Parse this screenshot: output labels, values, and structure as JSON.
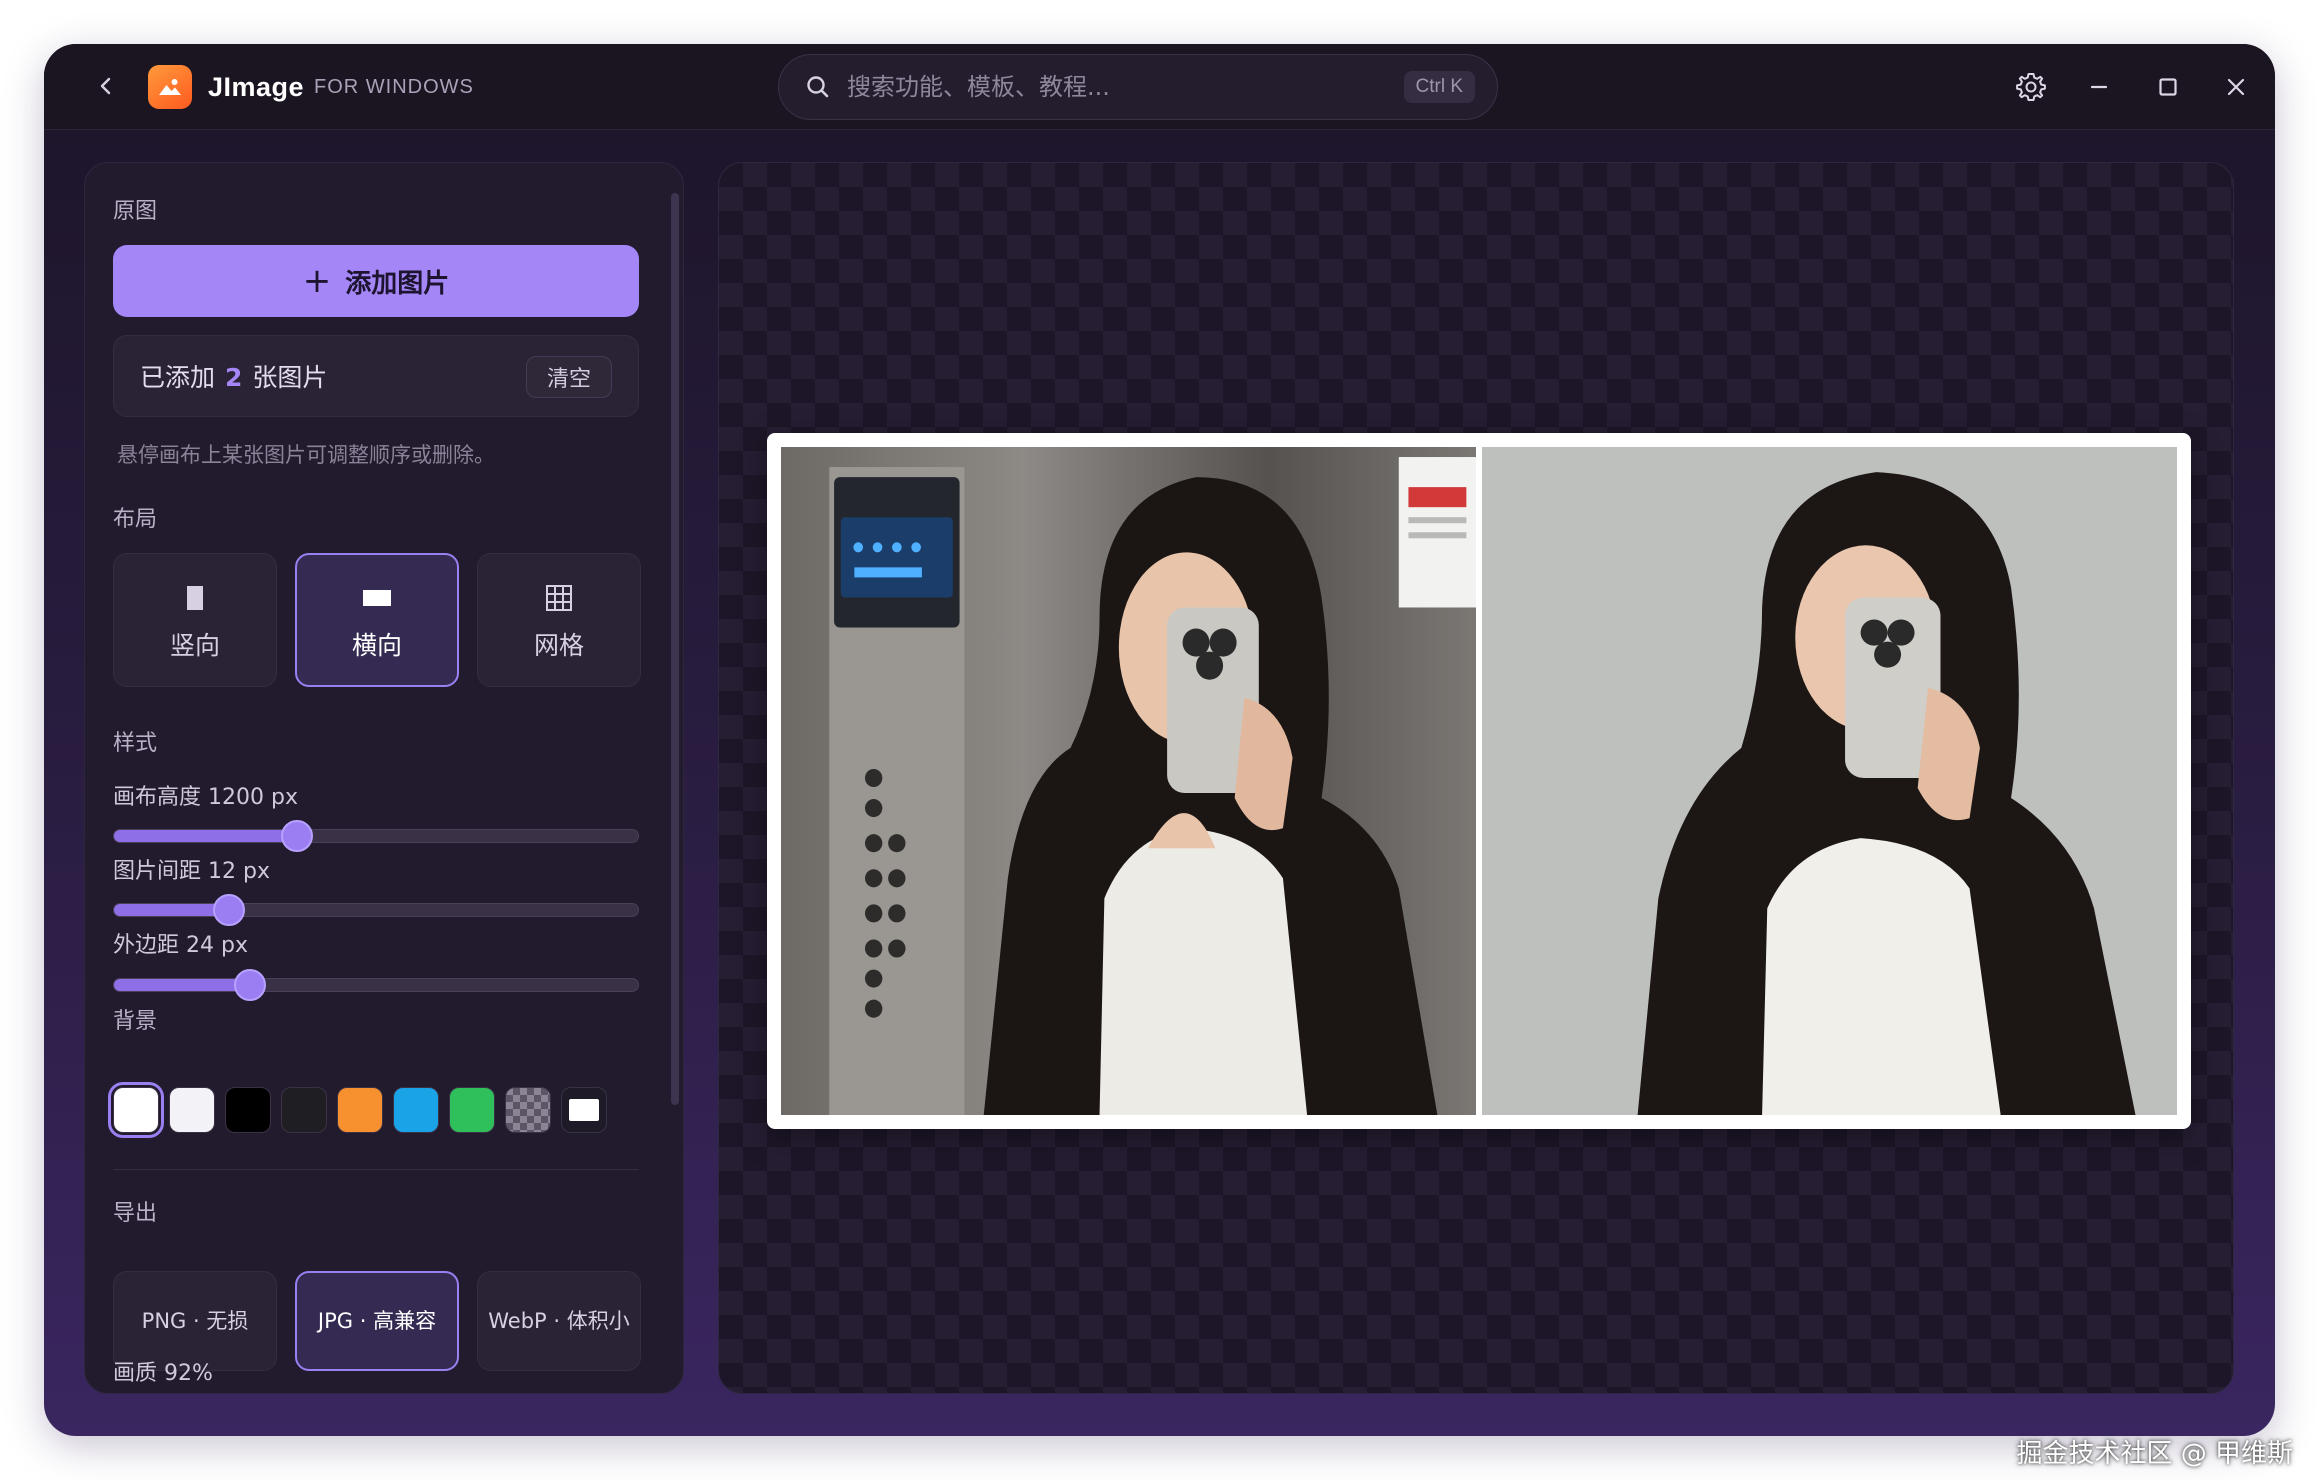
{
  "titlebar": {
    "app_name": "JImage",
    "app_sub": "FOR WINDOWS",
    "search_placeholder": "搜索功能、模板、教程...",
    "search_shortcut": "Ctrl K"
  },
  "sidebar": {
    "source_label": "原图",
    "add_button": "添加图片",
    "added_prefix": "已添加",
    "added_count": "2",
    "added_suffix": "张图片",
    "clear_button": "清空",
    "hint": "悬停画布上某张图片可调整顺序或删除。",
    "layout_label": "布局",
    "layouts": [
      {
        "label": "竖向",
        "active": false
      },
      {
        "label": "横向",
        "active": true
      },
      {
        "label": "网格",
        "active": false
      }
    ],
    "style_label": "样式",
    "sliders": [
      {
        "label": "画布高度 1200 px",
        "fraction": 0.35
      },
      {
        "label": "图片间距 12 px",
        "fraction": 0.22
      },
      {
        "label": "外边距 24 px",
        "fraction": 0.26
      }
    ],
    "background_label": "背景",
    "background_colors": [
      "#ffffff",
      "#f3f2f7",
      "#000000",
      "#1f1f23",
      "#f7902f",
      "#1aa3e6",
      "#2fbf5b",
      "transparent",
      "white-frame"
    ],
    "selected_background": 0,
    "export_label": "导出",
    "formats": [
      {
        "label": "PNG · 无损",
        "active": false
      },
      {
        "label": "JPG · 高兼容",
        "active": true
      },
      {
        "label": "WebP · 体积小",
        "active": false
      }
    ],
    "quality_label": "画质 92%"
  },
  "watermark": "掘金技术社区 @ 甲维斯"
}
